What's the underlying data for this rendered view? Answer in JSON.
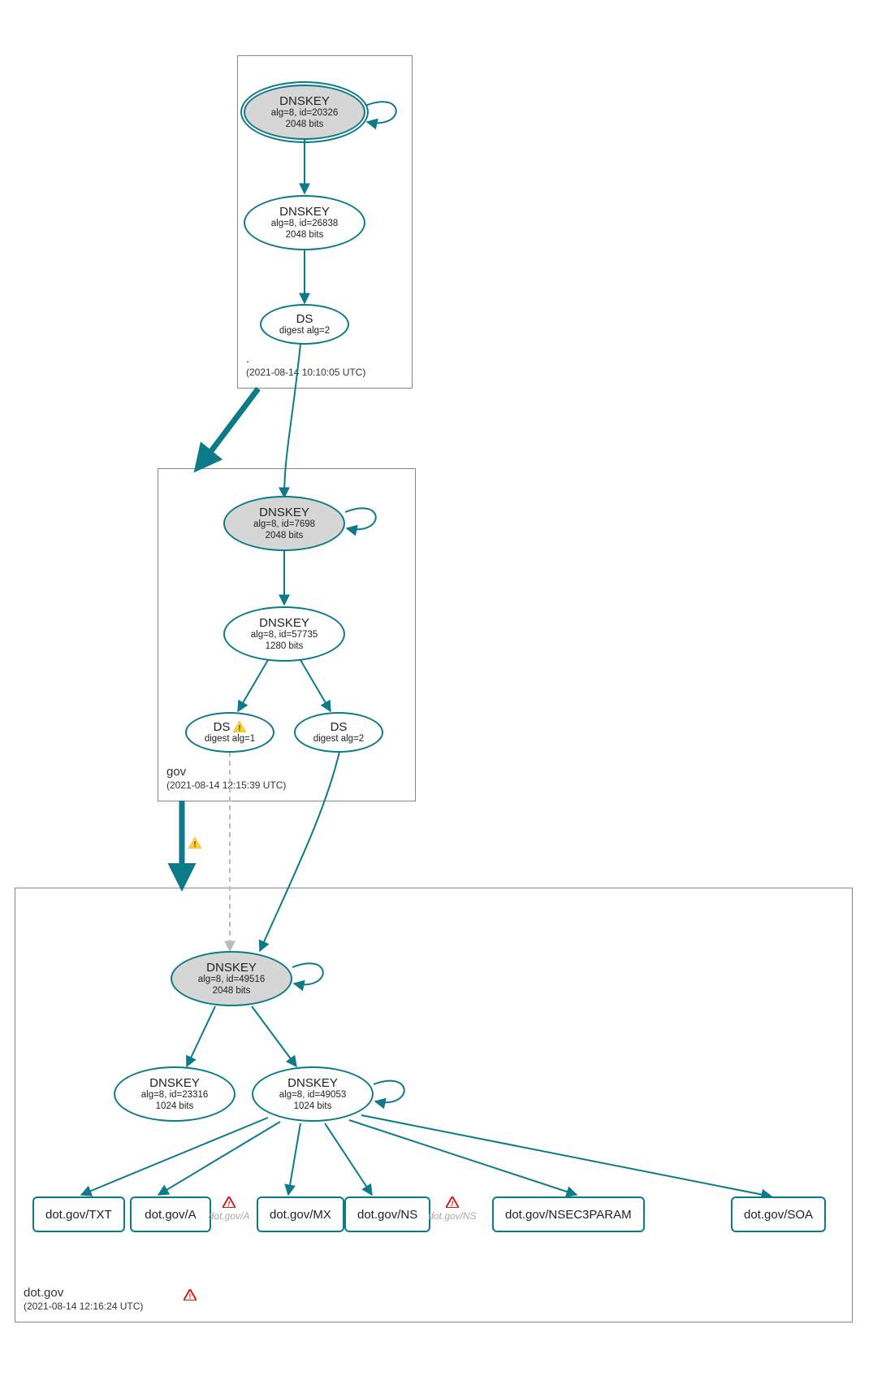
{
  "zones": {
    "root": {
      "name": ".",
      "timestamp": "(2021-08-14 10:10:05 UTC)",
      "nodes": {
        "ksk": {
          "title": "DNSKEY",
          "line2": "alg=8, id=20326",
          "line3": "2048 bits"
        },
        "zsk": {
          "title": "DNSKEY",
          "line2": "alg=8, id=26838",
          "line3": "2048 bits"
        },
        "ds": {
          "title": "DS",
          "line2": "digest alg=2"
        }
      }
    },
    "gov": {
      "name": "gov",
      "timestamp": "(2021-08-14 12:15:39 UTC)",
      "nodes": {
        "ksk": {
          "title": "DNSKEY",
          "line2": "alg=8, id=7698",
          "line3": "2048 bits"
        },
        "zsk": {
          "title": "DNSKEY",
          "line2": "alg=8, id=57735",
          "line3": "1280 bits"
        },
        "ds1": {
          "title": "DS",
          "line2": "digest alg=1",
          "warning": true
        },
        "ds2": {
          "title": "DS",
          "line2": "digest alg=2"
        }
      }
    },
    "dotgov": {
      "name": "dot.gov",
      "timestamp": "(2021-08-14 12:16:24 UTC)",
      "error": true,
      "nodes": {
        "ksk": {
          "title": "DNSKEY",
          "line2": "alg=8, id=49516",
          "line3": "2048 bits"
        },
        "zsk1": {
          "title": "DNSKEY",
          "line2": "alg=8, id=23316",
          "line3": "1024 bits"
        },
        "zsk2": {
          "title": "DNSKEY",
          "line2": "alg=8, id=49053",
          "line3": "1024 bits"
        },
        "rr_txt": {
          "label": "dot.gov/TXT"
        },
        "rr_a": {
          "label": "dot.gov/A"
        },
        "rr_a_err": {
          "label": "dot.gov/A",
          "error": true
        },
        "rr_mx": {
          "label": "dot.gov/MX"
        },
        "rr_ns": {
          "label": "dot.gov/NS"
        },
        "rr_ns_err": {
          "label": "dot.gov/NS",
          "error": true
        },
        "rr_nsec3p": {
          "label": "dot.gov/NSEC3PARAM"
        },
        "rr_soa": {
          "label": "dot.gov/SOA"
        }
      }
    }
  },
  "delegation_warning": true
}
